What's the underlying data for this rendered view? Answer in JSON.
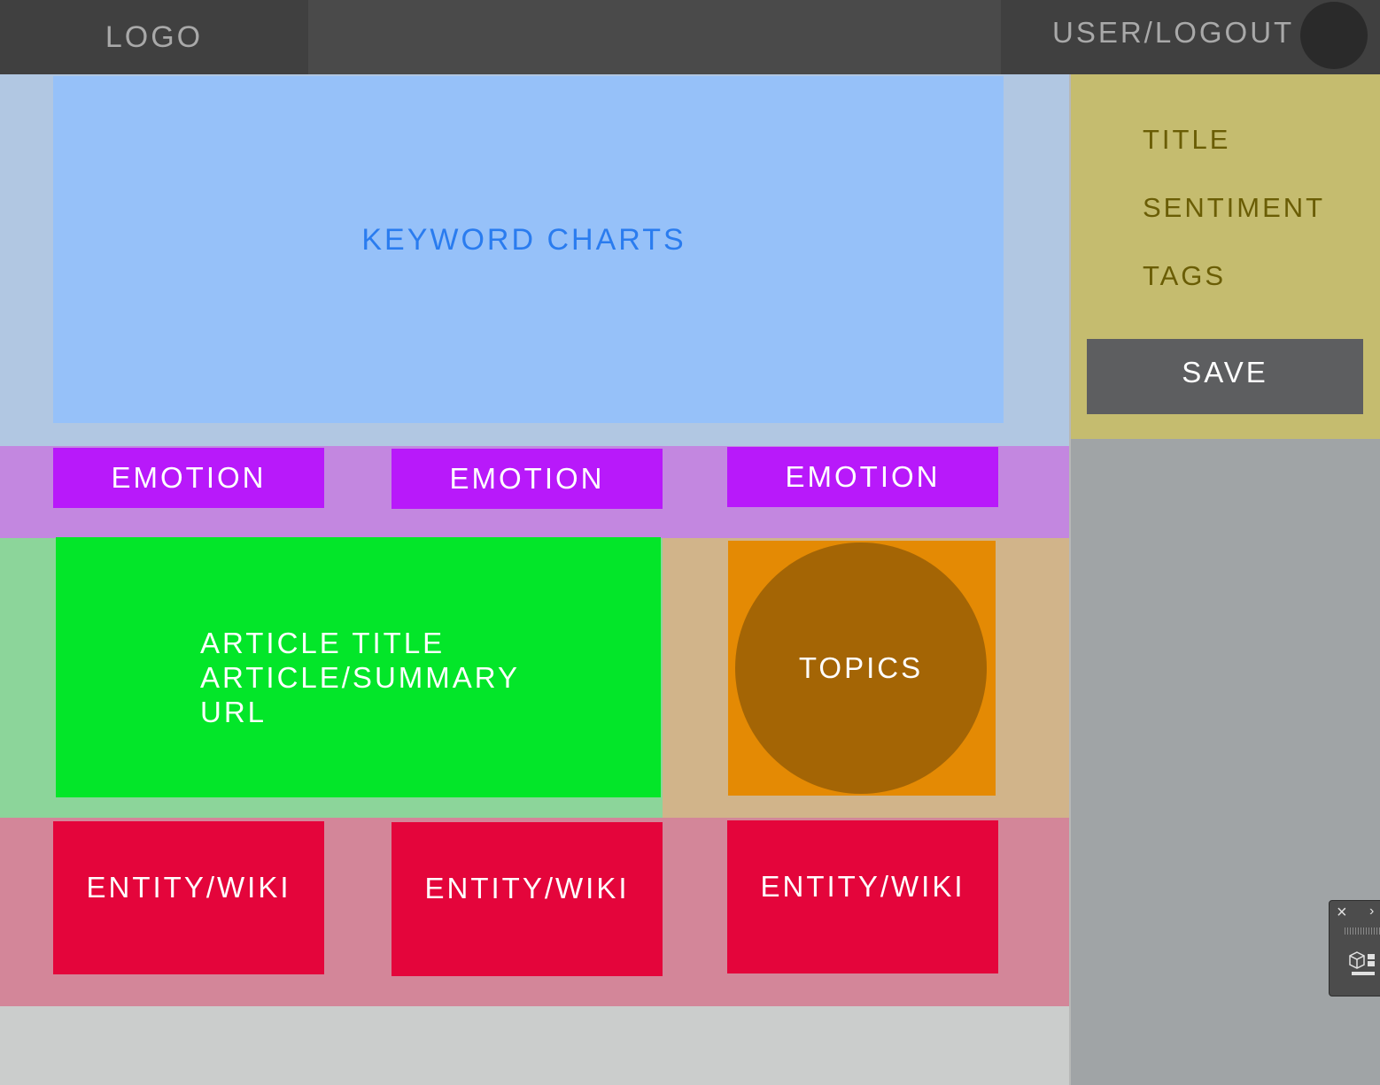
{
  "header": {
    "logo": "LOGO",
    "user_logout": "USER/LOGOUT"
  },
  "keyword": {
    "label": "KEYWORD CHARTS"
  },
  "emotions": [
    "EMOTION",
    "EMOTION",
    "EMOTION"
  ],
  "article": {
    "title": "ARTICLE TITLE",
    "summary": "ARTICLE/SUMMARY",
    "url": "URL"
  },
  "topics": {
    "label": "TOPICS"
  },
  "entities": [
    "ENTITY/WIKI",
    "ENTITY/WIKI",
    "ENTITY/WIKI"
  ],
  "sidebar": {
    "title": "TITLE",
    "sentiment": "SENTIMENT",
    "tags": "TAGS",
    "save_label": "SAVE"
  },
  "mini_panel": {
    "close_icon": "×",
    "expand_icon": "›"
  },
  "colors": {
    "header": "#4a4a4a",
    "keyword_box": "#96c1f9",
    "emotion_box": "#b819fa",
    "article_box": "#03e629",
    "topics_box": "#e48a04",
    "entity_box": "#e4053b",
    "sidebar": "#c5bc6f",
    "save_button": "#5d5e60"
  }
}
